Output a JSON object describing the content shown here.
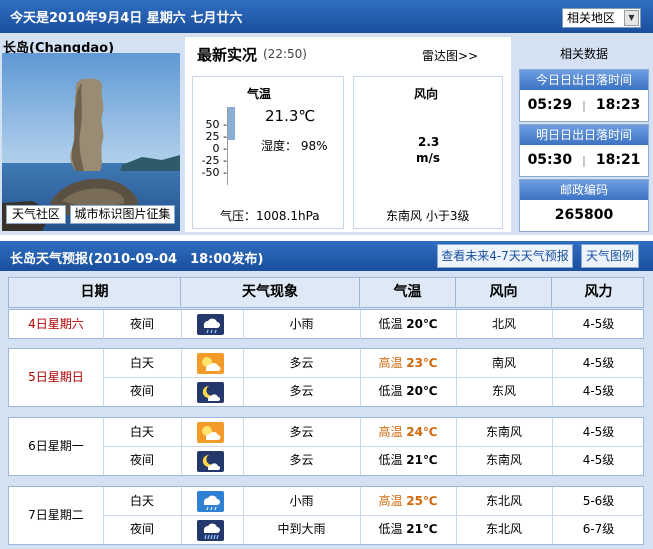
{
  "header": {
    "date_text": "今天是2010年9月4日 星期六 七月廿六",
    "region_select": "相关地区"
  },
  "city": {
    "name": "长岛(Changdao)",
    "link_community": "天气社区",
    "link_photos": "城市标识图片征集"
  },
  "realtime": {
    "title": "最新实况",
    "time": "(22:50)",
    "radar": "雷达图>>",
    "temp_label": "气温",
    "temp_value": "21.3℃",
    "humidity": "湿度： 98%",
    "pressure": "气压：1008.1hPa",
    "scale": [
      "50 -",
      "25 -",
      "0 -",
      "-25 -",
      "-50 -"
    ],
    "wind_label": "风向",
    "wind_speed": "2.3",
    "wind_unit": "m/s",
    "wind_desc": "东南风 小于3级"
  },
  "related": {
    "title": "相关数据",
    "today_label": "今日日出日落时间",
    "today_sunrise": "05:29",
    "today_sunset": "18:23",
    "tomorrow_label": "明日日出日落时间",
    "tomorrow_sunrise": "05:30",
    "tomorrow_sunset": "18:21",
    "postcode_label": "邮政编码",
    "postcode": "265800",
    "separator": "|"
  },
  "forecast": {
    "title": "长岛天气预报(2010-09-04　18:00发布)",
    "btn_4_7": "查看未来4-7天天气预报",
    "btn_legend": "天气图例",
    "headers": [
      "日期",
      "天气现象",
      "气温",
      "风向",
      "风力"
    ],
    "days": [
      {
        "date": "4日星期六",
        "rows": [
          {
            "period": "夜间",
            "icon": "light-rain-night",
            "weather": "小雨",
            "temp_label": "低温",
            "temp": "20℃",
            "wind": "北风",
            "force": "4-5级"
          }
        ]
      },
      {
        "date": "5日星期日",
        "rows": [
          {
            "period": "白天",
            "icon": "cloudy-day",
            "weather": "多云",
            "temp_label": "高温",
            "temp": "23℃",
            "wind": "南风",
            "force": "4-5级"
          },
          {
            "period": "夜间",
            "icon": "cloudy-night",
            "weather": "多云",
            "temp_label": "低温",
            "temp": "20℃",
            "wind": "东风",
            "force": "4-5级"
          }
        ]
      },
      {
        "date": "6日星期一",
        "rows": [
          {
            "period": "白天",
            "icon": "cloudy-day",
            "weather": "多云",
            "temp_label": "高温",
            "temp": "24℃",
            "wind": "东南风",
            "force": "4-5级"
          },
          {
            "period": "夜间",
            "icon": "cloudy-night",
            "weather": "多云",
            "temp_label": "低温",
            "temp": "21℃",
            "wind": "东南风",
            "force": "4-5级"
          }
        ]
      },
      {
        "date": "7日星期二",
        "rows": [
          {
            "period": "白天",
            "icon": "light-rain-day",
            "weather": "小雨",
            "temp_label": "高温",
            "temp": "25℃",
            "wind": "东北风",
            "force": "5-6级"
          },
          {
            "period": "夜间",
            "icon": "moderate-heavy-rain-night",
            "weather": "中到大雨",
            "temp_label": "低温",
            "temp": "21℃",
            "wind": "东北风",
            "force": "6-7级"
          }
        ]
      }
    ]
  },
  "colors": {
    "brand_blue": "#1a4f9d",
    "panel_bg": "#d3e1f3",
    "date_red": "#b10000",
    "high_temp": "#d2680c",
    "night_icon": "#24386b",
    "day_icon": "#f29a2a"
  }
}
